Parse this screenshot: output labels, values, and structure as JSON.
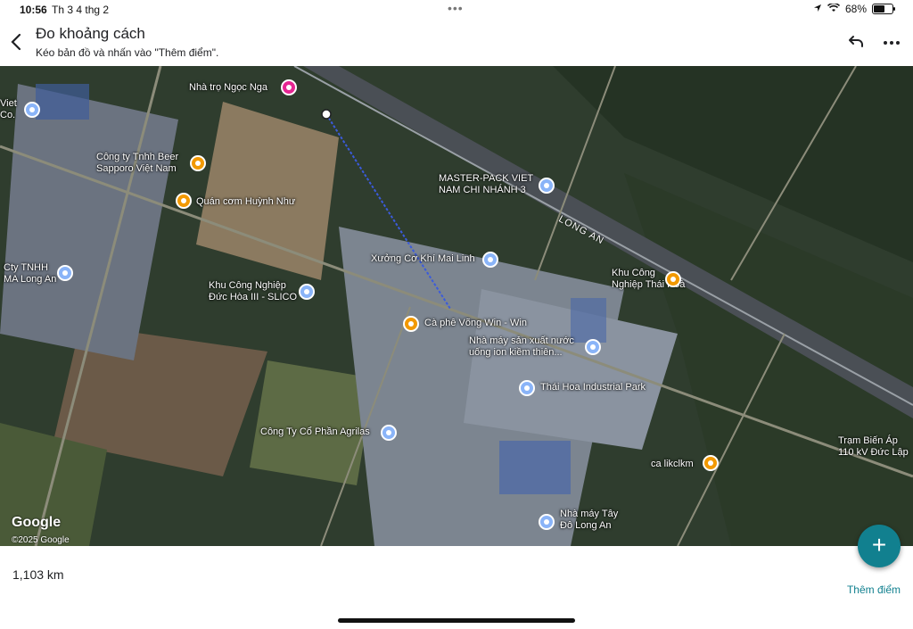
{
  "status_bar": {
    "time": "10:56",
    "date": "Th 3 4 thg 2",
    "battery": "68%",
    "battery_level": 0.68
  },
  "header": {
    "title": "Đo khoảng cách",
    "subtitle": "Kéo bản đồ và nhấn vào \"Thêm điểm\".",
    "back_icon": "chevron-left-icon",
    "undo_icon": "undo-icon",
    "more_icon": "more-horizontal-icon"
  },
  "map": {
    "places": [
      {
        "id": "nha-tro",
        "label": "Nhà trọ Ngọc Nga",
        "pin": "pink"
      },
      {
        "id": "viet-co",
        "label": "Viet\nCo.",
        "pin": "blue"
      },
      {
        "id": "sapporo",
        "label": "Công ty Tnhh Beer\nSapporo Việt Nam",
        "pin": "orange"
      },
      {
        "id": "quan-com",
        "label": "Quán cơm Huỳnh Như",
        "pin": "orange"
      },
      {
        "id": "master-pack",
        "label": "MASTER-PACK VIET\nNAM CHI NHÁNH 3",
        "pin": "blue"
      },
      {
        "id": "xuong",
        "label": "Xưởng Cơ Khí Mai Linh",
        "pin": "blue"
      },
      {
        "id": "kcn-thai-hoa",
        "label": "Khu Công\nNghiệp Thái Hoà",
        "pin": "orange"
      },
      {
        "id": "cty-tnhh",
        "label": "Cty TNHH\nMA Long An",
        "pin": "blue"
      },
      {
        "id": "kcn-duc-hoa",
        "label": "Khu Công Nghiệp\nĐức Hòa III - SLICO",
        "pin": "blue"
      },
      {
        "id": "ca-phe",
        "label": "Cà phê Võng Win - Win",
        "pin": "orange"
      },
      {
        "id": "nha-may-nuoc",
        "label": "Nhà máy sản xuất nước\nuống ion kiềm thiên...",
        "pin": "blue"
      },
      {
        "id": "thai-hoa-park",
        "label": "Thái Hoa Industrial Park",
        "pin": "blue"
      },
      {
        "id": "agrilas",
        "label": "Công Ty Cổ Phần Agrilas",
        "pin": "blue"
      },
      {
        "id": "tram-bien-ap",
        "label": "Trạm Biến Áp\n110 kV Đức Lập",
        "pin": "none"
      },
      {
        "id": "ca-likclkm",
        "label": "ca likclkm",
        "pin": "orange"
      },
      {
        "id": "nha-may-tay-do",
        "label": "Nhà máy Tây\nĐô Long An",
        "pin": "blue"
      }
    ],
    "road_label": "LONG AN",
    "logo": "Google",
    "copyright": "©2025 Google"
  },
  "footer": {
    "distance": "1,103 km",
    "add_point": "Thêm điểm",
    "fab_icon": "plus-icon"
  },
  "colors": {
    "accent": "#11808f",
    "measure_line": "#3b5bdb"
  }
}
